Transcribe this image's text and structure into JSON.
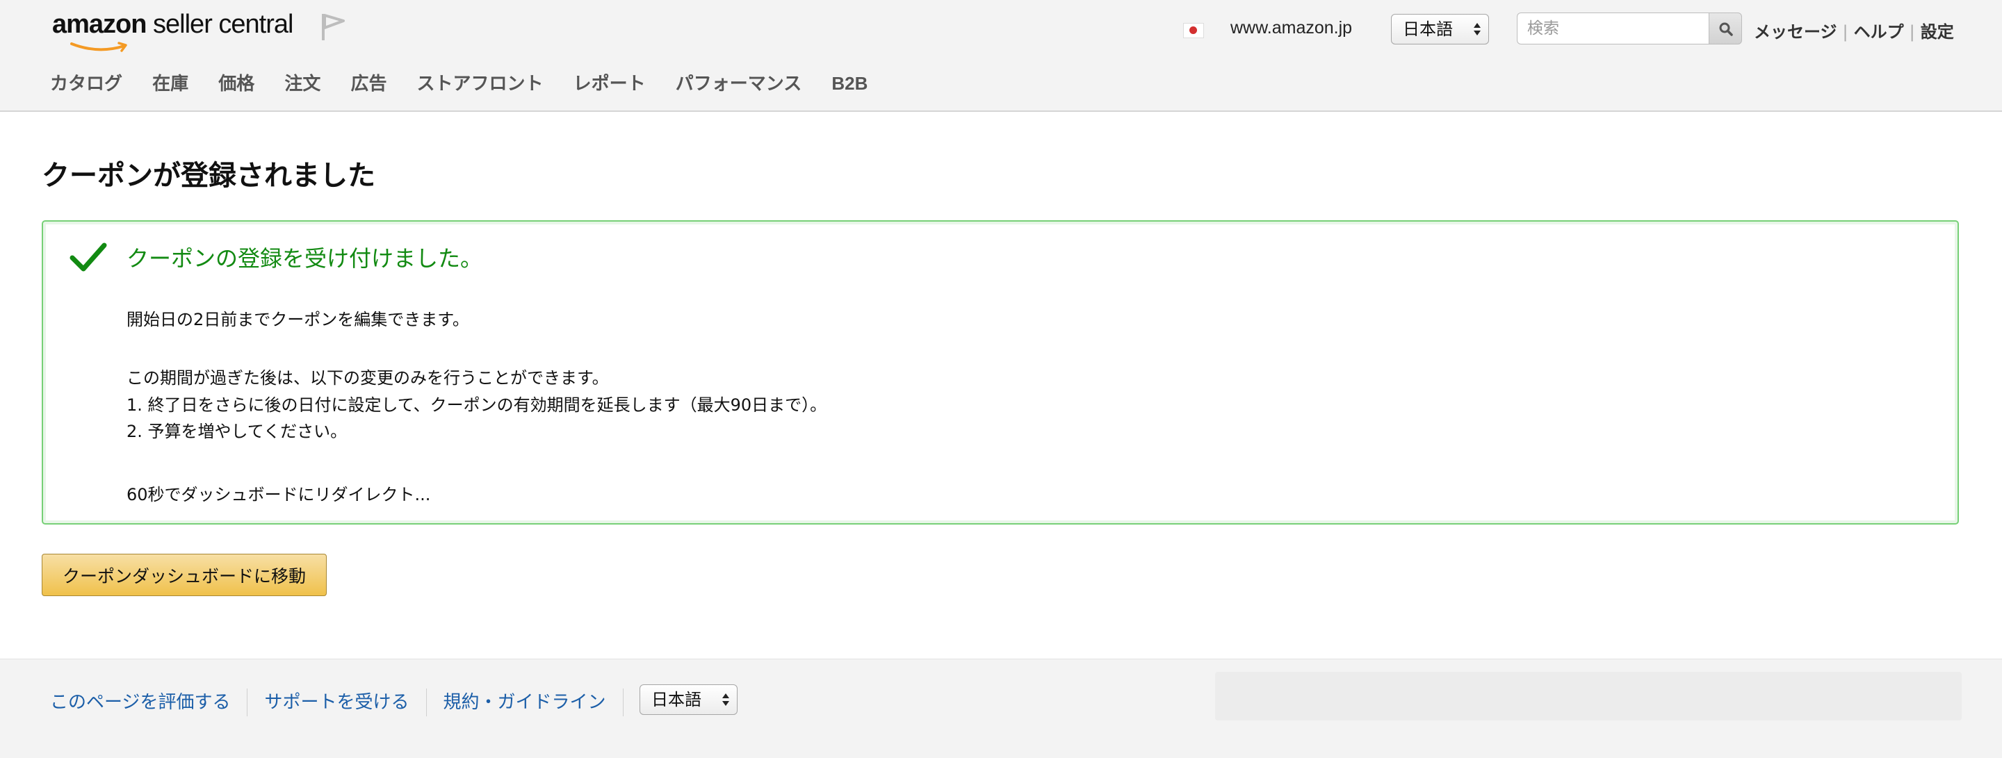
{
  "header": {
    "logo_brand": "amazon",
    "logo_product": " seller central",
    "marketplace": "www.amazon.jp",
    "language": "日本語",
    "search_placeholder": "検索",
    "top_links": [
      "メッセージ",
      "ヘルプ",
      "設定"
    ],
    "nav": [
      "カタログ",
      "在庫",
      "価格",
      "注文",
      "広告",
      "ストアフロント",
      "レポート",
      "パフォーマンス",
      "B2B"
    ]
  },
  "main": {
    "title": "クーポンが登録されました",
    "alert": {
      "heading": "クーポンの登録を受け付けました。",
      "edit_note": "開始日の2日前までクーポンを編集できます。",
      "after_period": "この期間が過ぎた後は、以下の変更のみを行うことができます。",
      "option1": "1. 終了日をさらに後の日付に設定して、クーポンの有効期間を延長します（最大90日まで）。",
      "option2": "2. 予算を増やしてください。",
      "redirect": "60秒でダッシュボードにリダイレクト..."
    },
    "button_label": "クーポンダッシュボードに移動"
  },
  "footer": {
    "links": [
      "このページを評価する",
      "サポートを受ける",
      "規約・ガイドライン"
    ],
    "language": "日本語"
  },
  "colors": {
    "success_green": "#128a12",
    "alert_border": "#77d077",
    "button_yellow": "#f0c14b",
    "link_blue": "#1b5ea8"
  },
  "icons": [
    "amazon-smile-icon",
    "flag-icon",
    "japan-flag-icon",
    "search-icon",
    "check-icon",
    "select-arrows-icon"
  ]
}
